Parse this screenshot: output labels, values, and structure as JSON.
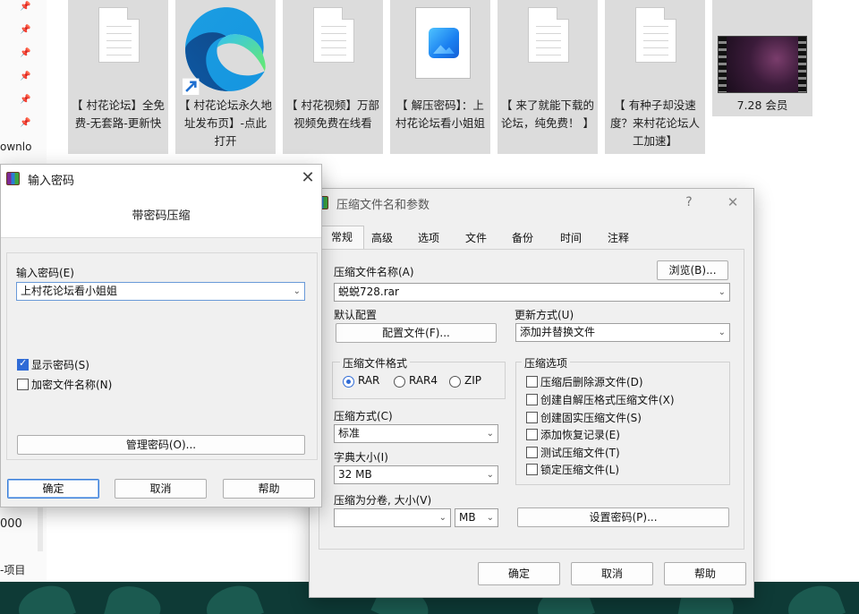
{
  "explorer": {
    "sidebar_text": [
      "ownlo",
      "000",
      "-项目"
    ],
    "files": [
      {
        "label": "【 村花论坛】全免费-无套路-更新快",
        "icon": "text-document-icon"
      },
      {
        "label": "【 村花论坛永久地址发布页】-点此打开",
        "icon": "edge-shortcut-icon"
      },
      {
        "label": "【 村花视频】万部视频免费在线看",
        "icon": "text-document-icon"
      },
      {
        "label": "【 解压密码】：上村花论坛看小姐姐",
        "icon": "image-document-icon"
      },
      {
        "label": "【 来了就能下载的论坛，纯免费！ 】",
        "icon": "text-document-icon"
      },
      {
        "label": "【 有种子却没速度？来村花论坛人工加速】",
        "icon": "text-document-icon"
      },
      {
        "label": "7.28 会员",
        "icon": "video-thumbnail-icon"
      }
    ]
  },
  "password_dialog": {
    "title": "输入密码",
    "heading": "带密码压缩",
    "password_label": "输入密码(E)",
    "password_value": "上村花论坛看小姐姐",
    "show_password_label": "显示密码(S)",
    "show_password_checked": true,
    "encrypt_names_label": "加密文件名称(N)",
    "encrypt_names_checked": false,
    "manage_button": "管理密码(O)...",
    "ok_button": "确定",
    "cancel_button": "取消",
    "help_button": "帮助"
  },
  "archive_dialog": {
    "title": "压缩文件名和参数",
    "help_glyph": "?",
    "close_glyph": "✕",
    "tabs": [
      "常规",
      "高级",
      "选项",
      "文件",
      "备份",
      "时间",
      "注释"
    ],
    "active_tab": "常规",
    "archive_name_label": "压缩文件名称(A)",
    "browse_button": "浏览(B)...",
    "archive_name_value": "蜕蜕728.rar",
    "default_profile_label": "默认配置",
    "profile_button": "配置文件(F)...",
    "update_mode_label": "更新方式(U)",
    "update_mode_value": "添加并替换文件",
    "format_group_title": "压缩文件格式",
    "formats": [
      {
        "label": "RAR",
        "checked": true
      },
      {
        "label": "RAR4",
        "checked": false
      },
      {
        "label": "ZIP",
        "checked": false
      }
    ],
    "options_group_title": "压缩选项",
    "options": [
      {
        "label": "压缩后删除源文件(D)",
        "checked": false
      },
      {
        "label": "创建自解压格式压缩文件(X)",
        "checked": false
      },
      {
        "label": "创建固实压缩文件(S)",
        "checked": false
      },
      {
        "label": "添加恢复记录(E)",
        "checked": false
      },
      {
        "label": "测试压缩文件(T)",
        "checked": false
      },
      {
        "label": "锁定压缩文件(L)",
        "checked": false
      }
    ],
    "method_label": "压缩方式(C)",
    "method_value": "标准",
    "dict_label": "字典大小(I)",
    "dict_value": "32 MB",
    "split_label": "压缩为分卷, 大小(V)",
    "split_value": "",
    "split_unit": "MB",
    "set_password_button": "设置密码(P)...",
    "ok_button": "确定",
    "cancel_button": "取消",
    "help_button": "帮助"
  }
}
